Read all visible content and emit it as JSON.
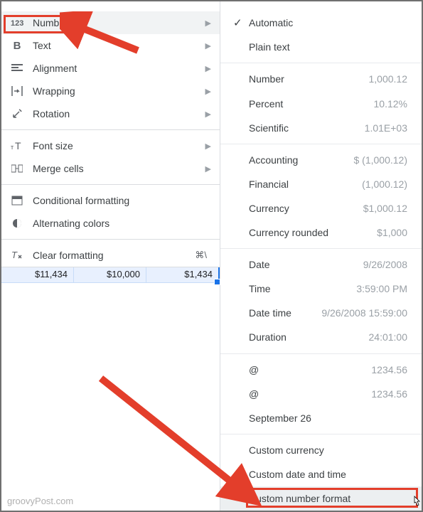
{
  "left_menu": {
    "number": "Number",
    "text": "Text",
    "alignment": "Alignment",
    "wrapping": "Wrapping",
    "rotation": "Rotation",
    "font_size": "Font size",
    "merge_cells": "Merge cells",
    "conditional_formatting": "Conditional formatting",
    "alternating_colors": "Alternating colors",
    "clear_formatting": "Clear formatting",
    "clear_shortcut": "⌘\\"
  },
  "spreadsheet": {
    "cells": [
      "$11,434",
      "$10,000",
      "$1,434"
    ]
  },
  "right_menu": {
    "automatic": "Automatic",
    "plain_text": "Plain text",
    "number": {
      "label": "Number",
      "val": "1,000.12"
    },
    "percent": {
      "label": "Percent",
      "val": "10.12%"
    },
    "scientific": {
      "label": "Scientific",
      "val": "1.01E+03"
    },
    "accounting": {
      "label": "Accounting",
      "val": "$ (1,000.12)"
    },
    "financial": {
      "label": "Financial",
      "val": "(1,000.12)"
    },
    "currency": {
      "label": "Currency",
      "val": "$1,000.12"
    },
    "currency_rounded": {
      "label": "Currency rounded",
      "val": "$1,000"
    },
    "date": {
      "label": "Date",
      "val": "9/26/2008"
    },
    "time": {
      "label": "Time",
      "val": "3:59:00 PM"
    },
    "date_time": {
      "label": "Date time",
      "val": "9/26/2008 15:59:00"
    },
    "duration": {
      "label": "Duration",
      "val": "24:01:00"
    },
    "at1": {
      "label": "@",
      "val": "1234.56"
    },
    "at2": {
      "label": "@",
      "val": "1234.56"
    },
    "sep26": "September 26",
    "custom_currency": "Custom currency",
    "custom_date_time": "Custom date and time",
    "custom_number_format": "Custom number format"
  },
  "watermark": "groovyPost.com"
}
